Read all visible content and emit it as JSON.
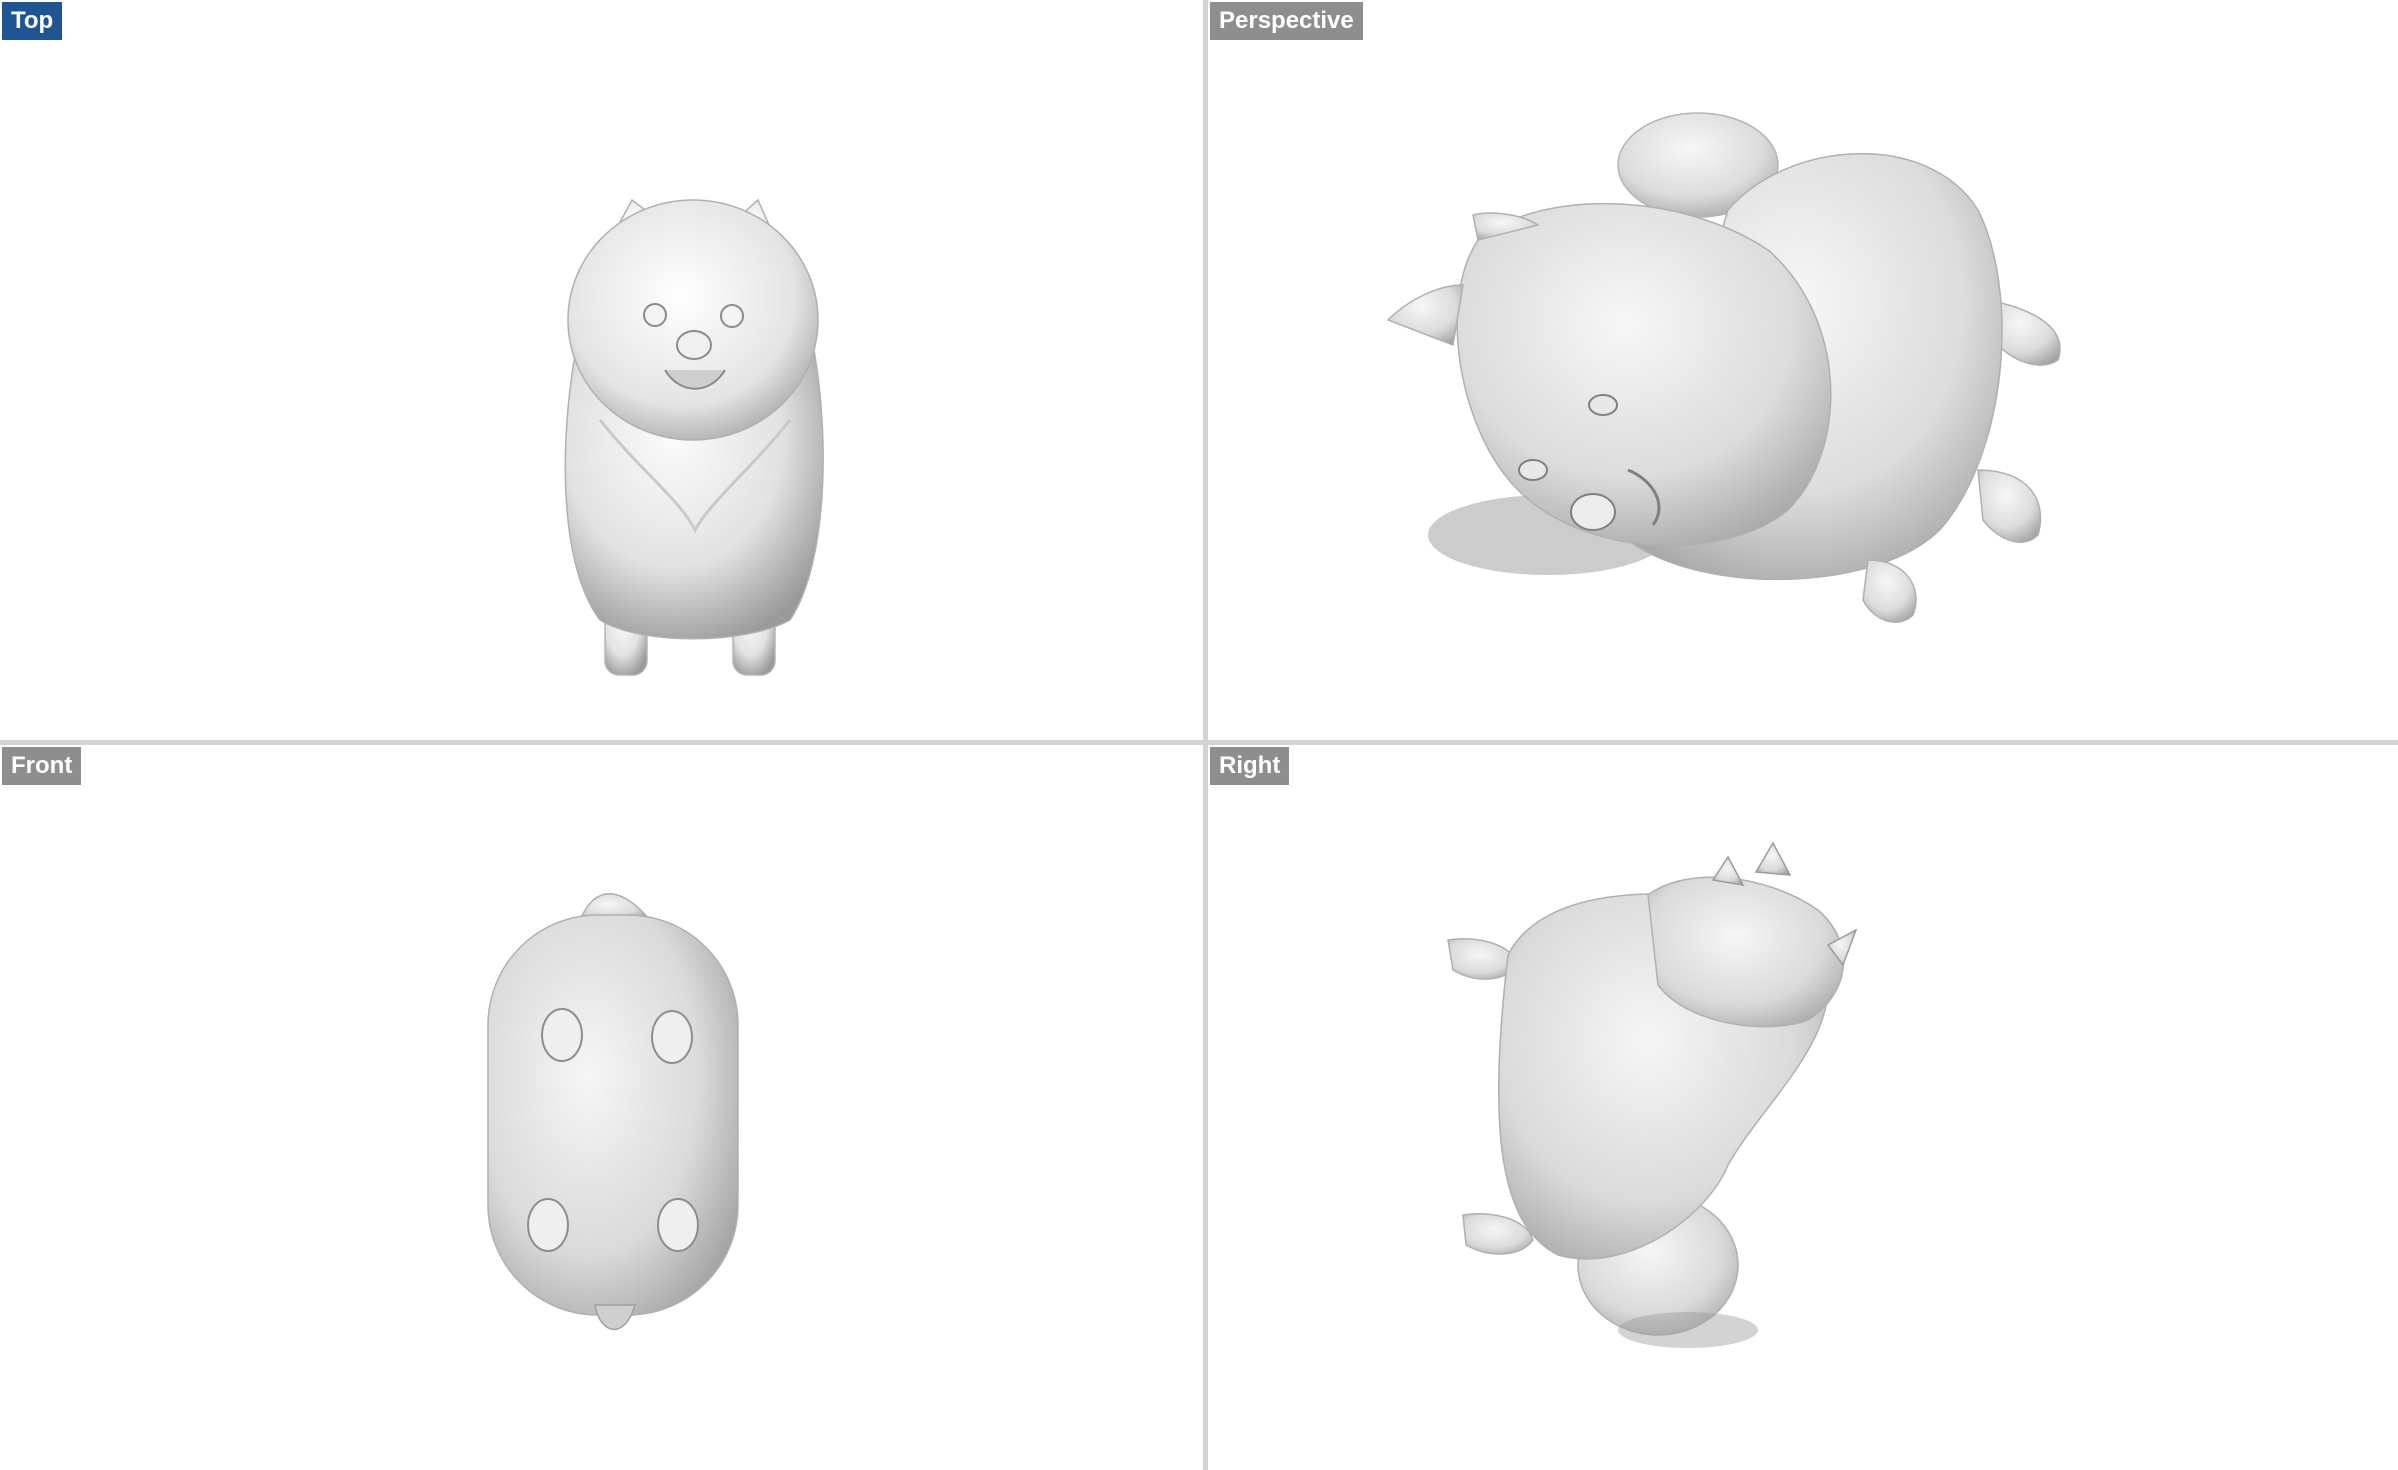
{
  "viewports": {
    "top": {
      "label": "Top",
      "active": true
    },
    "perspective": {
      "label": "Perspective",
      "active": false
    },
    "front": {
      "label": "Front",
      "active": false
    },
    "right": {
      "label": "Right",
      "active": false
    }
  },
  "model": {
    "subject": "pomeranian dog sculpt",
    "display_mode": "shaded",
    "surface_color": "#e6e6e6"
  },
  "colors": {
    "active_label_bg": "#1f5592",
    "inactive_label_bg": "#8e8e8e",
    "divider": "#d4d4d4",
    "viewport_bg": "#ffffff"
  }
}
